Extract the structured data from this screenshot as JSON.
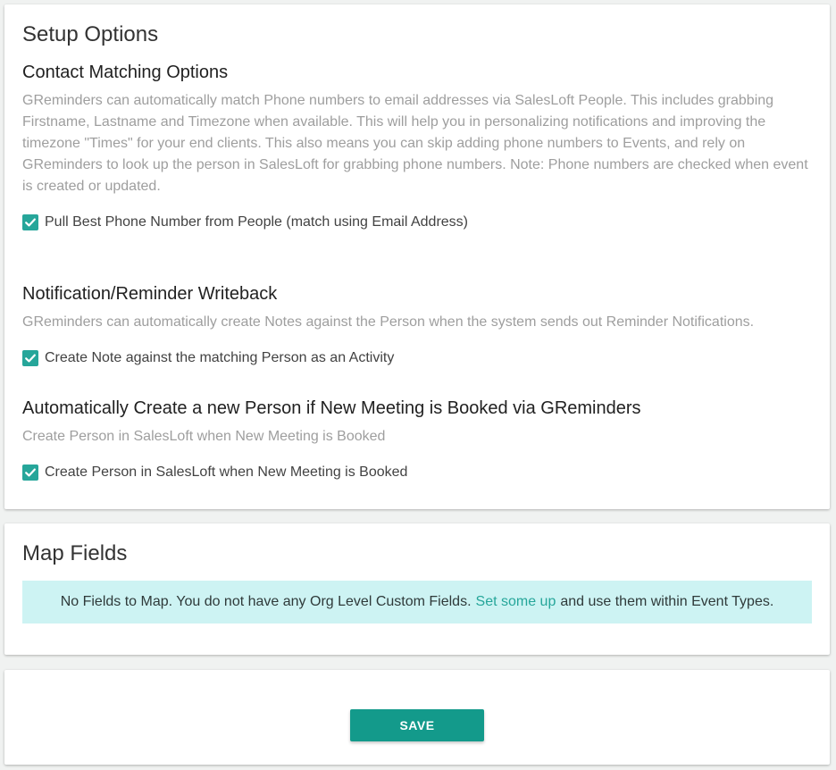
{
  "setup": {
    "title": "Setup Options",
    "contact_matching": {
      "title": "Contact Matching Options",
      "description": "GReminders can automatically match Phone numbers to email addresses via SalesLoft People. This includes grabbing Firstname, Lastname and Timezone when available. This will help you in personalizing notifications and improving the timezone \"Times\" for your end clients. This also means you can skip adding phone numbers to Events, and rely on GReminders to look up the person in SalesLoft for grabbing phone numbers. Note: Phone numbers are checked when event is created or updated.",
      "checkbox_label": "Pull Best Phone Number from People (match using Email Address)",
      "checked": true
    },
    "writeback": {
      "title": "Notification/Reminder Writeback",
      "description": "GReminders can automatically create Notes against the Person when the system sends out Reminder Notifications.",
      "checkbox_label": "Create Note against the matching Person as an Activity",
      "checked": true
    },
    "auto_create": {
      "title": "Automatically Create a new Person if New Meeting is Booked via GReminders",
      "description": "Create Person in SalesLoft when New Meeting is Booked",
      "checkbox_label": "Create Person in SalesLoft when New Meeting is Booked",
      "checked": true
    }
  },
  "map_fields": {
    "title": "Map Fields",
    "info_before": "No Fields to Map. You do not have any Org Level Custom Fields.",
    "info_link": "Set some up",
    "info_after": "and use them within Event Types."
  },
  "actions": {
    "save_label": "SAVE"
  },
  "colors": {
    "accent": "#26a69a",
    "button": "#139a8b",
    "info_bg": "#cdf3f3"
  }
}
